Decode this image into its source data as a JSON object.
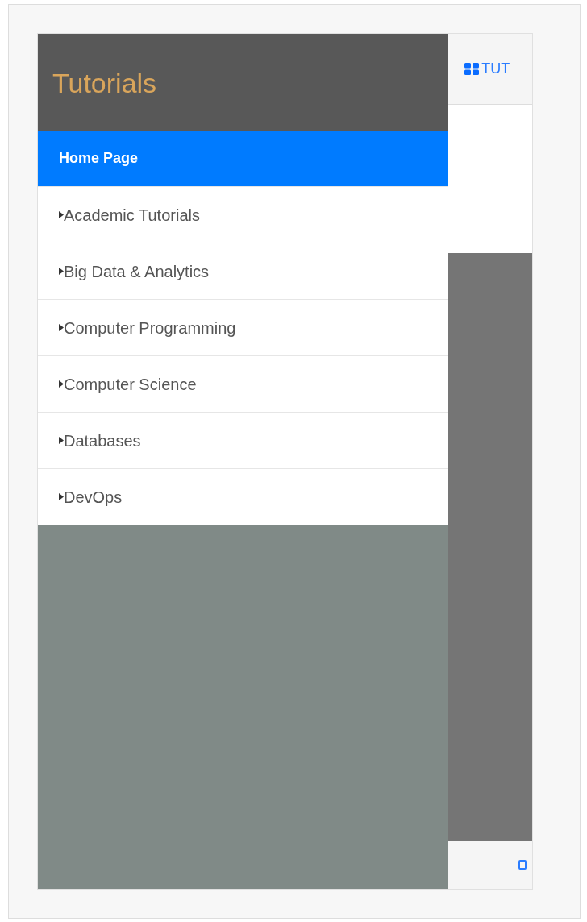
{
  "sidebar": {
    "title": "Tutorials",
    "items": [
      {
        "label": "Home Page",
        "selected": true,
        "kind": "link"
      },
      {
        "label": "Academic Tutorials",
        "selected": false,
        "kind": "category"
      },
      {
        "label": "Big Data & Analytics",
        "selected": false,
        "kind": "category"
      },
      {
        "label": "Computer Programming",
        "selected": false,
        "kind": "category"
      },
      {
        "label": "Computer Science",
        "selected": false,
        "kind": "category"
      },
      {
        "label": "Databases",
        "selected": false,
        "kind": "category"
      },
      {
        "label": "DevOps",
        "selected": false,
        "kind": "category"
      }
    ]
  },
  "topbar": {
    "label": "TUT"
  }
}
